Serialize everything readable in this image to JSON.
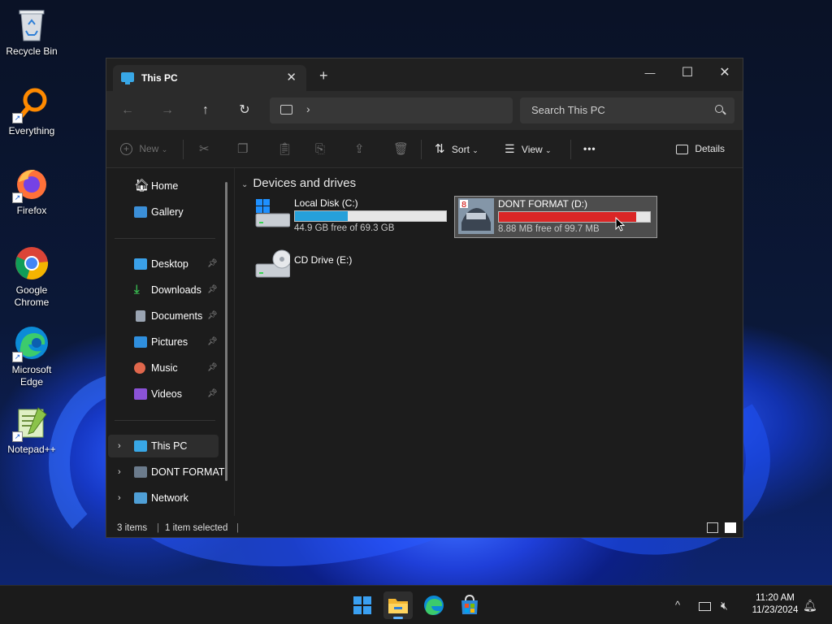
{
  "desktop": {
    "icons": [
      {
        "label": "Recycle Bin",
        "icon": "recycle-bin-icon"
      },
      {
        "label": "Everything",
        "icon": "everything-search-icon"
      },
      {
        "label": "Firefox",
        "icon": "firefox-icon"
      },
      {
        "label": "Google Chrome",
        "icon": "chrome-icon"
      },
      {
        "label": "Microsoft Edge",
        "icon": "edge-icon"
      },
      {
        "label": "Notepad++",
        "icon": "notepad-plus-plus-icon"
      }
    ]
  },
  "window": {
    "tab_title": "This PC",
    "new_tab_symbol": "+",
    "controls": {
      "minimize": "—",
      "maximize": "☐",
      "close": "✕"
    },
    "search_placeholder": "Search This PC",
    "address_chevron": "›",
    "commands": {
      "new": "New",
      "sort": "Sort",
      "view": "View",
      "more": "•••",
      "details": "Details"
    },
    "nav": {
      "quick": [
        {
          "label": "Home",
          "icon": "home-icon"
        },
        {
          "label": "Gallery",
          "icon": "gallery-icon"
        }
      ],
      "pinned": [
        {
          "label": "Desktop",
          "icon": "desktop-folder-icon",
          "color": "#3aa0e8"
        },
        {
          "label": "Downloads",
          "icon": "downloads-icon",
          "color": "#37b24d"
        },
        {
          "label": "Documents",
          "icon": "documents-icon",
          "color": "#9aa4b2"
        },
        {
          "label": "Pictures",
          "icon": "pictures-icon",
          "color": "#2f8fde"
        },
        {
          "label": "Music",
          "icon": "music-icon",
          "color": "#e0674c"
        },
        {
          "label": "Videos",
          "icon": "videos-icon",
          "color": "#8a52d6"
        }
      ],
      "tree": [
        {
          "label": "This PC",
          "icon": "this-pc-icon"
        },
        {
          "label": "DONT FORMAT",
          "icon": "drive-thumbnail-icon"
        },
        {
          "label": "Network",
          "icon": "network-icon"
        }
      ]
    },
    "content": {
      "group_title": "Devices and drives",
      "drives": [
        {
          "name": "Local Disk (C:)",
          "free": "44.9 GB free of 69.3 GB",
          "used_fraction": 0.35,
          "bar_color": "#26a0da"
        },
        {
          "name": "DONT FORMAT (D:)",
          "free": "8.88 MB free of 99.7 MB",
          "used_fraction": 0.91,
          "bar_color": "#da2626"
        },
        {
          "name": "CD Drive (E:)"
        }
      ]
    },
    "status": {
      "items": "3 items",
      "selected": "1 item selected"
    }
  },
  "taskbar": {
    "apps": [
      {
        "name": "start-button"
      },
      {
        "name": "file-explorer",
        "active": true
      },
      {
        "name": "edge"
      },
      {
        "name": "microsoft-store"
      }
    ],
    "time": "11:20 AM",
    "date": "11/23/2024"
  }
}
